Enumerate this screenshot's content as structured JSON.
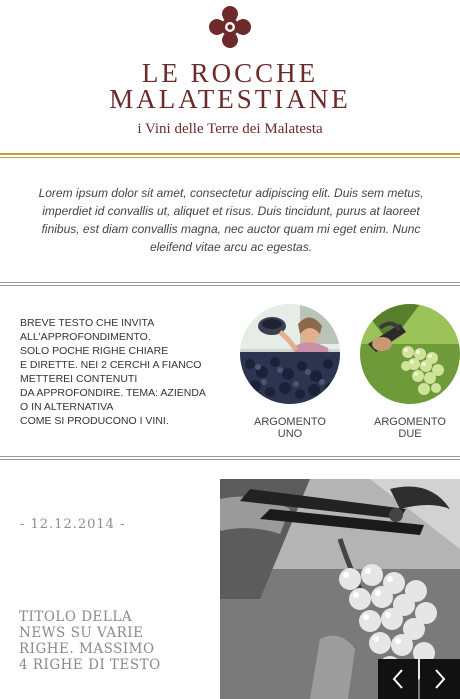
{
  "header": {
    "brand_line1": "LE ROCCHE",
    "brand_line2": "MALATESTIANE",
    "tagline": "i Vini delle Terre dei Malatesta",
    "logo_icon": "rosette-icon",
    "brand_color": "#6e2a2a",
    "accent_color": "#b9a640"
  },
  "intro": {
    "text": "Lorem ipsum dolor sit amet, consectetur adipiscing elit. Duis sem metus, imperdiet id convallis ut, aliquet et risus. Duis tincidunt, purus at laoreet finibus, est diam convallis magna, nec auctor quam mi eget enim. Nunc eleifend vitae arcu ac egestas."
  },
  "invite": {
    "lines": [
      "BREVE TESTO CHE INVITA",
      "ALL'APPROFONDIMENTO.",
      "SOLO POCHE RIGHE CHIARE",
      "E DIRETTE. NEI 2 CERCHI A FIANCO",
      "METTEREI CONTENUTI",
      "DA APPROFONDIRE. TEMA: AZIENDA",
      "O IN ALTERNATIVA",
      "COME SI PRODUCONO I VINI."
    ]
  },
  "topics": [
    {
      "label_line1": "ARGOMENTO",
      "label_line2": "UNO"
    },
    {
      "label_line1": "ARGOMENTO",
      "label_line2": "DUE"
    }
  ],
  "news": {
    "date": "- 12.12.2014 -",
    "title_lines": [
      "TITOLO DELLA",
      "NEWS SU VARIE",
      "RIGHE. MASSIMO",
      "4 RIGHE DI TESTO"
    ]
  },
  "slider": {
    "prev_icon": "chevron-left-icon",
    "next_icon": "chevron-right-icon"
  }
}
